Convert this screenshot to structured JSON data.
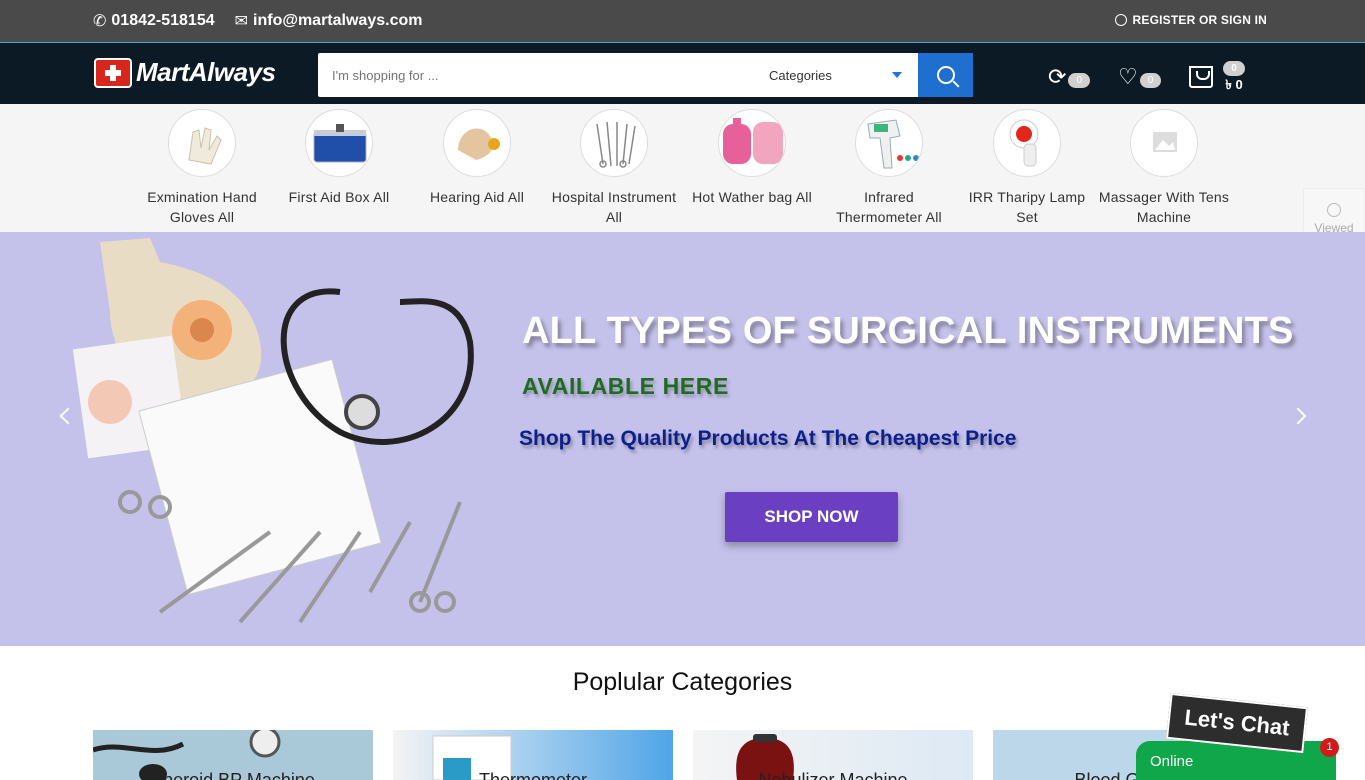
{
  "topbar": {
    "phone": "01842-518154",
    "email": "info@martalways.com",
    "auth": "REGISTER OR SIGN IN"
  },
  "header": {
    "logo": "MartAlways",
    "search_placeholder": "I'm shopping for ...",
    "categories_label": "Categories",
    "compare_count": "0",
    "wishlist_count": "0",
    "cart_count": "0",
    "cart_total": "৳ 0"
  },
  "categories": [
    {
      "label": "Exmination Hand Gloves All"
    },
    {
      "label": "First Aid Box All"
    },
    {
      "label": "Hearing Aid All"
    },
    {
      "label": "Hospital Instrument All"
    },
    {
      "label": "Hot Wather bag All"
    },
    {
      "label": "Infrared Thermometer All"
    },
    {
      "label": "IRR Tharipy Lamp Set"
    },
    {
      "label": "Massager With Tens Machine"
    }
  ],
  "viewed_label": "Viewed",
  "hero": {
    "title": "ALL TYPES OF SURGICAL INSTRUMENTS",
    "subtitle": "AVAILABLE HERE",
    "tagline": "Shop The Quality Products At The Cheapest Price",
    "cta": "SHOP NOW"
  },
  "popular": {
    "title": "Poplular Categories",
    "cards": [
      {
        "label": "Aneroid BP Machine"
      },
      {
        "label": "Thermometer"
      },
      {
        "label": "Nebulizer Machine"
      },
      {
        "label": "Blood Glucose"
      }
    ]
  },
  "chat": {
    "tag": "Let's Chat",
    "status": "Online",
    "count": "1"
  },
  "colors": {
    "accent": "#1f6fd1",
    "cta": "#6a3fc1",
    "online": "#10a64a"
  }
}
